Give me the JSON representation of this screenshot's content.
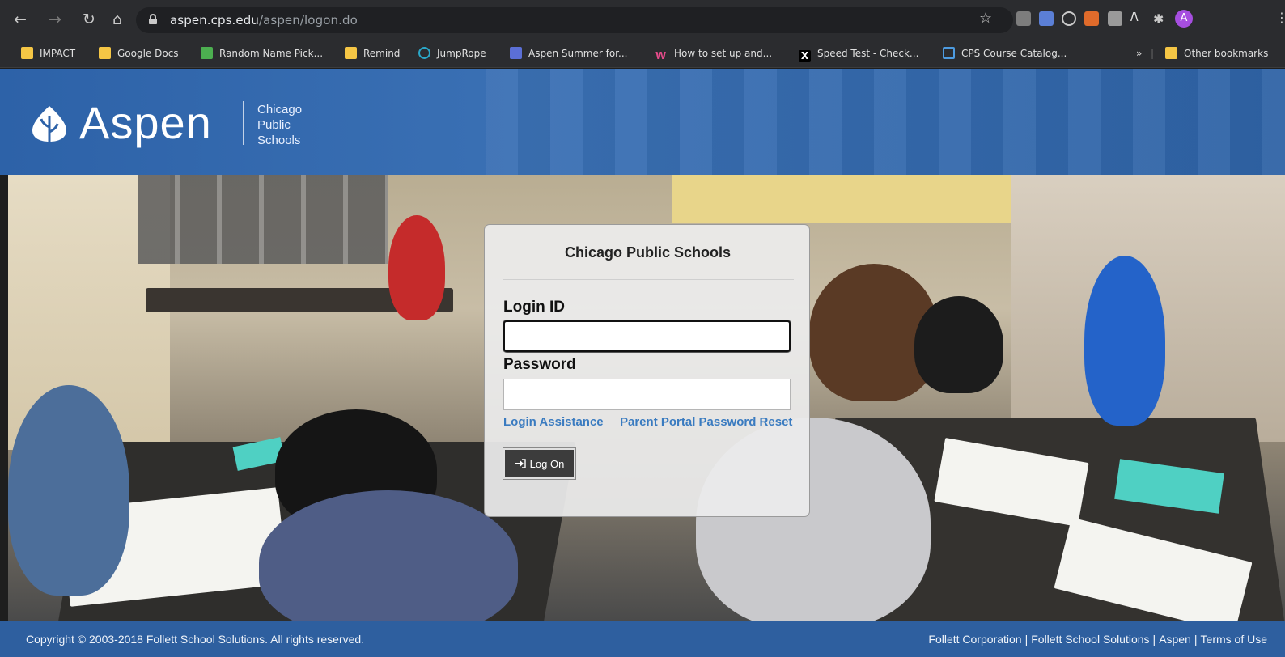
{
  "browser": {
    "url_host": "aspen.cps.edu",
    "url_path": "/aspen/logon.do",
    "nav_icons": [
      "back-arrow-icon",
      "forward-arrow-icon",
      "reload-icon",
      "home-icon"
    ],
    "bookmarks": [
      {
        "label": "IMPACT",
        "icon": "folder-icon"
      },
      {
        "label": "Google Docs",
        "icon": "folder-icon"
      },
      {
        "label": "Random Name Pick...",
        "icon": "green-puzzle-icon"
      },
      {
        "label": "Remind",
        "icon": "folder-icon"
      },
      {
        "label": "JumpRope",
        "icon": "jumprope-icon"
      },
      {
        "label": "Aspen Summer for...",
        "icon": "google-forms-icon"
      },
      {
        "label": "How to set up and...",
        "icon": "w-logo-icon"
      },
      {
        "label": "Speed Test - Check...",
        "icon": "x-logo-icon"
      },
      {
        "label": "CPS Course Catalog...",
        "icon": "catalog-icon"
      }
    ],
    "overflow_label": "»",
    "other_bookmarks": "Other bookmarks"
  },
  "header": {
    "logo_word": "Aspen",
    "logo_sub_1": "Chicago",
    "logo_sub_2": "Public",
    "logo_sub_3": "Schools"
  },
  "login": {
    "title": "Chicago Public Schools",
    "login_id_label": "Login ID",
    "login_id_value": "",
    "password_label": "Password",
    "password_value": "",
    "assistance_link": "Login Assistance",
    "reset_link": "Parent Portal Password Reset",
    "logon_button": "Log On"
  },
  "footer": {
    "copyright": "Copyright © 2003-2018 Follett School Solutions. All rights reserved.",
    "links": [
      "Follett Corporation",
      "Follett School Solutions",
      "Aspen",
      "Terms of Use"
    ],
    "separator": "|"
  },
  "colors": {
    "header_blue": "#2d62a8",
    "footer_blue": "#2e5f9f",
    "link_blue": "#3a7bc0",
    "button_dark": "#3c3c3c"
  }
}
